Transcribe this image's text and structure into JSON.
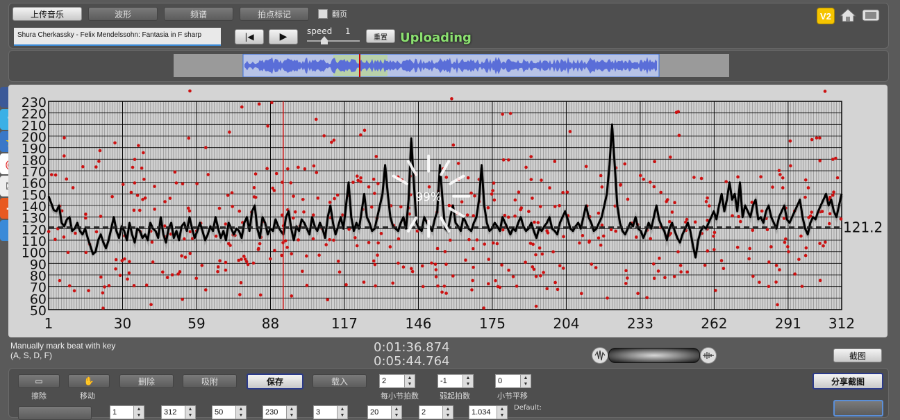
{
  "toolbar": {
    "upload_music": "上传音乐",
    "waveform": "波形",
    "spectrum": "频谱",
    "tap_mark": "拍点标记",
    "page_flip": "翻页",
    "song_title": "Shura Cherkassky - Felix Mendelssohn:  Fantasia in F sharp",
    "speed_label": "speed",
    "speed_value": "1",
    "reset": "重置",
    "status": "Uploading",
    "v2": "V2"
  },
  "chart": {
    "y_ticks": [
      "230",
      "220",
      "210",
      "200",
      "190",
      "180",
      "170",
      "160",
      "150",
      "140",
      "130",
      "120",
      "110",
      "100",
      "90",
      "80",
      "70",
      "60",
      "50"
    ],
    "x_ticks": [
      "1",
      "30",
      "59",
      "88",
      "117",
      "146",
      "175",
      "204",
      "233",
      "262",
      "291",
      "312"
    ],
    "avg_label": "121.2",
    "progress": "99%"
  },
  "chart_data": {
    "type": "line",
    "xlim": [
      1,
      312
    ],
    "ylim": [
      50,
      230
    ],
    "average": 121.2,
    "marker_x": 93,
    "series": [
      {
        "values": [
          148,
          142,
          136,
          135,
          140,
          125,
          122,
          128,
          130,
          118,
          120,
          125,
          118,
          115,
          120,
          112,
          105,
          98,
          100,
          110,
          115,
          108,
          103,
          110,
          120,
          130,
          118,
          112,
          122,
          118,
          110,
          125,
          115,
          108,
          120,
          118,
          112,
          115,
          110,
          125,
          120,
          118,
          112,
          130,
          115,
          108,
          120,
          125,
          112,
          118,
          110,
          122,
          125,
          118,
          130,
          120,
          112,
          118,
          125,
          118,
          110,
          115,
          122,
          118,
          130,
          120,
          112,
          118,
          110,
          125,
          120,
          115,
          120,
          118,
          112,
          125,
          130,
          118,
          135,
          140,
          120,
          112,
          130,
          125,
          115,
          120,
          118,
          128,
          122,
          118,
          115,
          130,
          135,
          120,
          110,
          122,
          118,
          128,
          125,
          120,
          115,
          130,
          122,
          118,
          125,
          120,
          112,
          130,
          140,
          125,
          115,
          122,
          130,
          120,
          140,
          160,
          130,
          118,
          125,
          120,
          135,
          150,
          130,
          125,
          118,
          120,
          130,
          140,
          150,
          175,
          150,
          130,
          122,
          120,
          118,
          125,
          130,
          120,
          145,
          198,
          160,
          125,
          120,
          118,
          130,
          125,
          122,
          118,
          128,
          135,
          175,
          145,
          120,
          118,
          130,
          140,
          125,
          122,
          118,
          130,
          125,
          120,
          118,
          125,
          130,
          145,
          175,
          140,
          125,
          118,
          120,
          125,
          122,
          118,
          130,
          125,
          120,
          115,
          120,
          118,
          125,
          130,
          122,
          118,
          120,
          125,
          118,
          112,
          120,
          118,
          122,
          125,
          130,
          120,
          118,
          115,
          125,
          130,
          135,
          128,
          120,
          118,
          122,
          125,
          120,
          130,
          140,
          130,
          125,
          118,
          120,
          125,
          130,
          140,
          150,
          175,
          210,
          175,
          140,
          125,
          118,
          115,
          120,
          125,
          122,
          130,
          120,
          118,
          112,
          118,
          125,
          120,
          130,
          140,
          128,
          122,
          118,
          110,
          120,
          125,
          118,
          112,
          108,
          115,
          120,
          125,
          118,
          105,
          95,
          110,
          118,
          122,
          120,
          125,
          130,
          135,
          128,
          140,
          150,
          135,
          145,
          160,
          145,
          150,
          135,
          160,
          130,
          140,
          135,
          130,
          140,
          145,
          128,
          130,
          125,
          135,
          140,
          130,
          125,
          120,
          130,
          135,
          140,
          128,
          125,
          130,
          135,
          140,
          145,
          130,
          120,
          115,
          125,
          130,
          128,
          135,
          140,
          145,
          150,
          140,
          145,
          135,
          130,
          140,
          150
        ]
      }
    ]
  },
  "transport": {
    "hint_line1": "Manually mark beat with key",
    "hint_line2": "(A, S, D, F)",
    "time_current": "0:01:36.874",
    "time_total": "0:05:44.764",
    "screenshot": "截图"
  },
  "bottom": {
    "erase_label": "擦除",
    "move_label": "移动",
    "delete": "删除",
    "snap": "吸附",
    "save": "保存",
    "load": "载入",
    "beats_per_bar_value": "2",
    "beats_per_bar_label": "每小节拍数",
    "pickup_value": "-1",
    "pickup_label": "弱起拍数",
    "shift_value": "0",
    "shift_label": "小节平移",
    "share": "分享截图",
    "row2_values": [
      "1",
      "312",
      "50",
      "230",
      "3",
      "20",
      "2",
      "1.034"
    ],
    "default_label": "Default:"
  }
}
